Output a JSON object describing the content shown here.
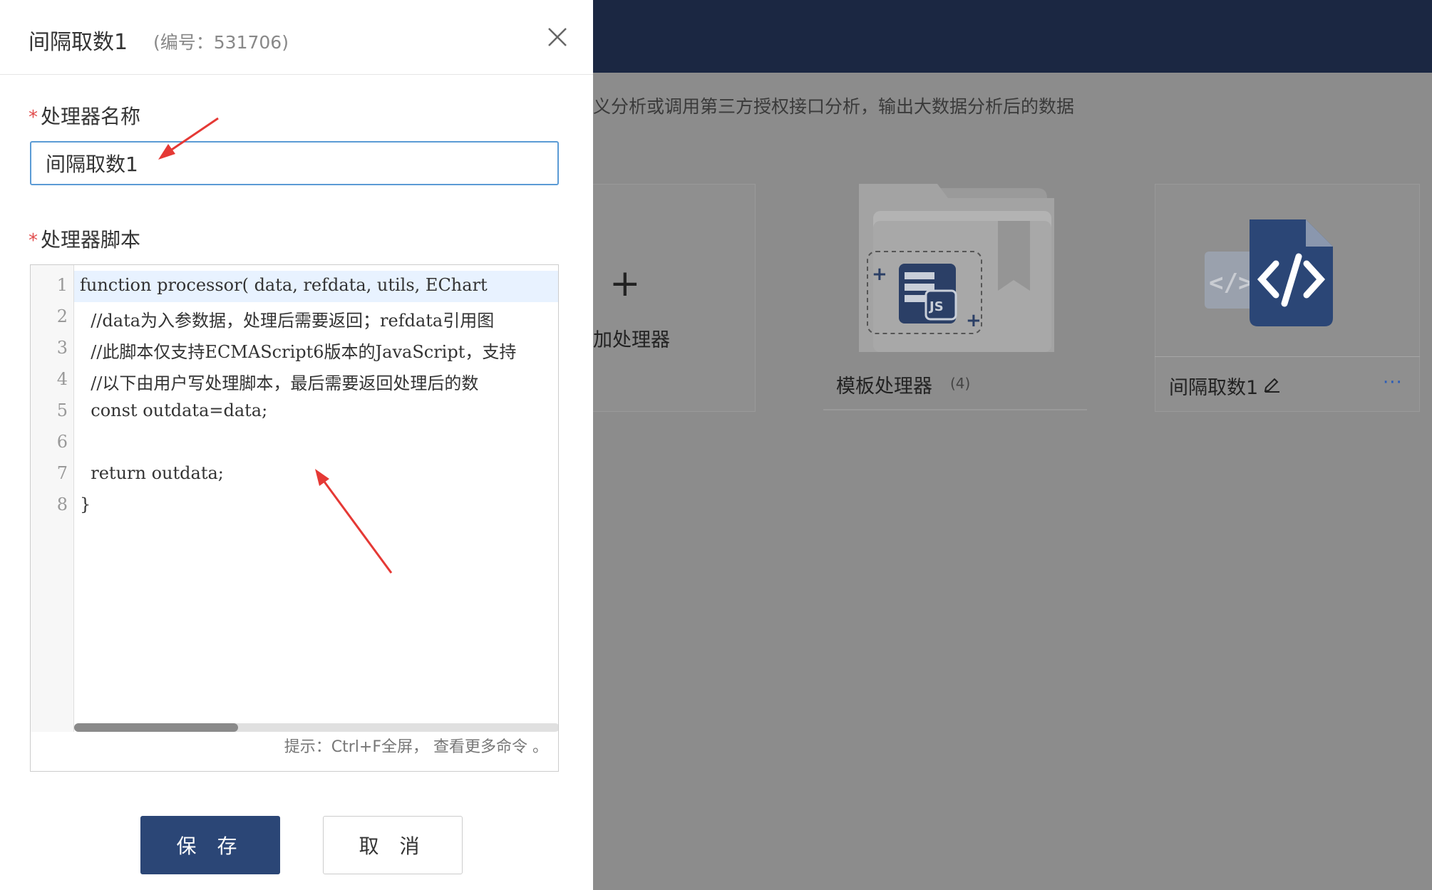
{
  "background": {
    "description": "义分析或调用第三方授权接口分析，输出大数据分析后的数据",
    "add_card": {
      "icon": "plus-icon",
      "label": "加处理器"
    },
    "template_card": {
      "icon": "folder-js-icon",
      "label": "模板处理器",
      "count": "(4)"
    },
    "processor_card": {
      "icon": "code-file-icon",
      "label": "间隔取数1",
      "edit_icon": "pencil-icon",
      "more_icon": "ellipsis-icon",
      "more": "···"
    }
  },
  "drawer": {
    "title": "间隔取数1",
    "subtitle": "(编号：531706)",
    "close_icon": "close-icon",
    "name_field": {
      "required_mark": "*",
      "label": "处理器名称",
      "value": "间隔取数1"
    },
    "script_field": {
      "required_mark": "*",
      "label": "处理器脚本",
      "line_numbers": [
        "1",
        "2",
        "3",
        "4",
        "5",
        "6",
        "7",
        "8"
      ],
      "code_lines": [
        "function processor( data, refdata, utils, EChart",
        "  //data为入参数据，处理后需要返回；refdata引用图",
        "  //此脚本仅支持ECMAScript6版本的JavaScript，支持",
        "  //以下由用户写处理脚本，最后需要返回处理后的数",
        "  const outdata=data;",
        "",
        "  return outdata;",
        "}"
      ],
      "hint": "提示：Ctrl+F全屏，  查看更多命令 。"
    },
    "buttons": {
      "save": "保 存",
      "cancel": "取 消"
    }
  },
  "colors": {
    "topbar": "#1b2742",
    "primary": "#2b4676",
    "input_border": "#5b9bd5",
    "required": "#e14b4b",
    "annotation_arrow": "#e53935"
  }
}
